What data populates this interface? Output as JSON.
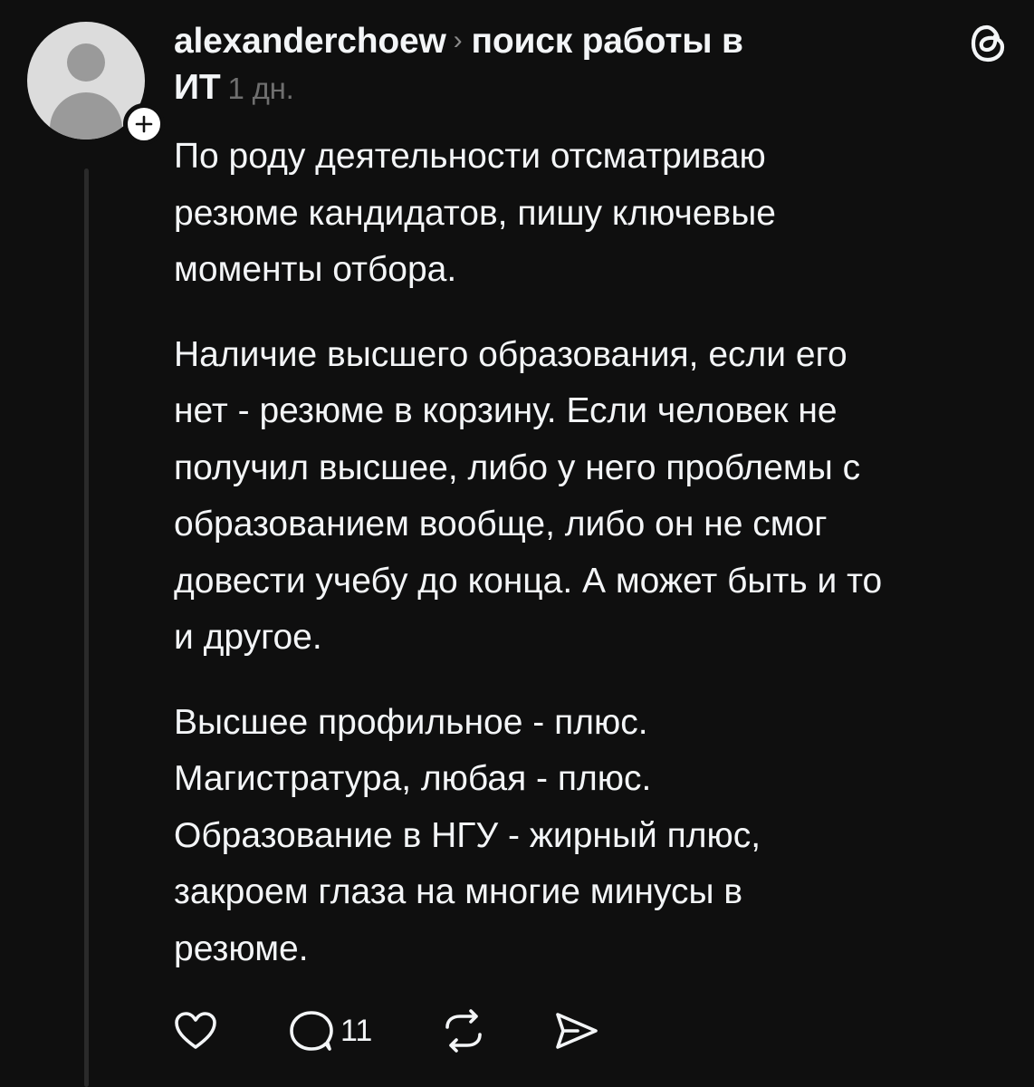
{
  "post": {
    "author": "alexanderchoew",
    "chevron": "›",
    "topic_line1": "поиск работы в",
    "topic_line2": "ИТ",
    "time": "1 дн.",
    "paragraphs": [
      "По роду деятельности отсматриваю\nрезюме кандидатов, пишу ключевые\nмоменты отбора.",
      "Наличие высшего образования, если его\nнет - резюме в корзину. Если человек не\nполучил высшее, либо у него проблемы с\nобразованием вообще, либо он не смог\nдовести учебу до конца. А может быть и то\nи другое.",
      "Высшее профильное - плюс.\nМагистратура, любая - плюс.\nОбразование в НГУ - жирный плюс,\nзакроем глаза на многие минусы в\nрезюме."
    ]
  },
  "actions": {
    "like_icon": "heart-icon",
    "reply_icon": "comment-icon",
    "reply_count": "11",
    "repost_icon": "repost-icon",
    "share_icon": "send-icon"
  },
  "icons": {
    "header_logo": "threads-logo-icon",
    "follow": "plus-icon"
  },
  "colors": {
    "background": "#0f0f0f",
    "text": "#f3f5f7",
    "muted": "#6f6f6f",
    "thread_line": "#2a2a2a"
  }
}
